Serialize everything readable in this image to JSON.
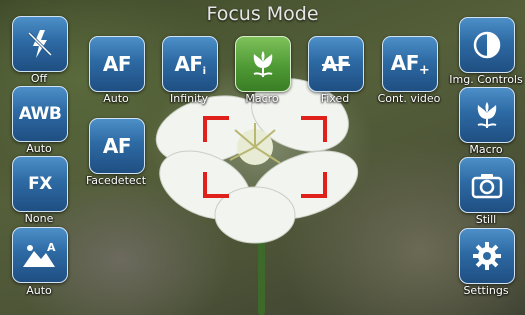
{
  "title": "Focus Mode",
  "colors": {
    "button": "#2d6aa4",
    "button_selected": "#4f9a35",
    "focus_bracket": "#e0201a"
  },
  "left_column": [
    {
      "icon": "flash-off-icon",
      "label": "Off"
    },
    {
      "glyph": "AWB",
      "label": "Auto"
    },
    {
      "glyph": "FX",
      "label": "None"
    },
    {
      "icon": "scene-mountains-auto-icon",
      "label": "Auto"
    }
  ],
  "focus_modes": [
    {
      "glyph": "AF",
      "label": "Auto",
      "selected": false
    },
    {
      "glyph": "AF",
      "label": "Infinity",
      "selected": false
    },
    {
      "icon": "macro-tulip-icon",
      "label": "Macro",
      "selected": true
    },
    {
      "glyph": "AF",
      "label": "Fixed",
      "selected": false
    },
    {
      "glyph": "AF",
      "label": "Cont. video",
      "selected": false
    },
    {
      "glyph": "AF",
      "label": "Facedetect",
      "selected": false
    }
  ],
  "right_column": [
    {
      "icon": "contrast-circle-icon",
      "label": "Img. Controls"
    },
    {
      "icon": "macro-tulip-icon",
      "label": "Macro"
    },
    {
      "icon": "camera-icon",
      "label": "Still"
    },
    {
      "icon": "gear-icon",
      "label": "Settings"
    }
  ]
}
